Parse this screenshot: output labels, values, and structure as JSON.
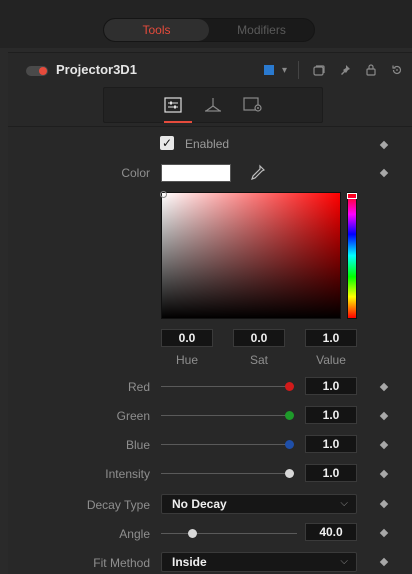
{
  "mode_switch": {
    "tools_label": "Tools",
    "modifiers_label": "Modifiers"
  },
  "tool": {
    "name": "Projector3D1",
    "color_hex": "#2a7ad0"
  },
  "controls": {
    "enabled_label": "Enabled",
    "enabled_checked": true,
    "color_label": "Color",
    "hue": {
      "value": "0.0",
      "label": "Hue"
    },
    "sat": {
      "value": "0.0",
      "label": "Sat"
    },
    "val": {
      "value": "1.0",
      "label": "Value"
    },
    "red": {
      "label": "Red",
      "value": "1.0",
      "knob_color": "#d11a1a",
      "fraction": 1.0
    },
    "green": {
      "label": "Green",
      "value": "1.0",
      "knob_color": "#1e9a2a",
      "fraction": 1.0
    },
    "blue": {
      "label": "Blue",
      "value": "1.0",
      "knob_color": "#1f4fa8",
      "fraction": 1.0
    },
    "intensity": {
      "label": "Intensity",
      "value": "1.0",
      "knob_color": "#d8d8d8",
      "fraction": 1.0
    },
    "decay_type": {
      "label": "Decay Type",
      "value": "No Decay"
    },
    "angle": {
      "label": "Angle",
      "value": "40.0",
      "fraction": 0.22
    },
    "fit_method": {
      "label": "Fit Method",
      "value": "Inside"
    }
  },
  "colors": {
    "accent": "#e64b3c",
    "panel": "#282828"
  }
}
